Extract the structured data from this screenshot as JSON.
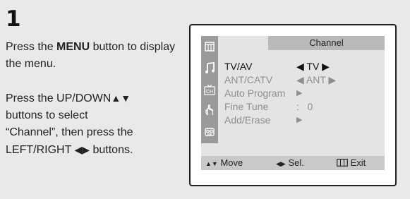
{
  "step": {
    "number": "1"
  },
  "instructions": {
    "p1_before": "Press the ",
    "p1_bold": "MENU",
    "p1_after": " button to display the menu.",
    "p2_line1": "Press the UP/DOWN",
    "p2_updown_glyph": "▲▼",
    "p2_line2": "buttons to select",
    "p2_line3": "“Channel”, then press the",
    "p2_line4_before": "LEFT/RIGHT ",
    "p2_leftright_glyph": "◀▶",
    "p2_line4_after": " buttons."
  },
  "osd": {
    "title": "Channel",
    "icons": [
      "picture-icon",
      "sound-icon",
      "channel-icon",
      "function-icon",
      "input-icon"
    ],
    "rows": [
      {
        "label": "TV/AV",
        "value": "◀ TV ▶",
        "state": "active"
      },
      {
        "label": "ANT/CATV",
        "value": "◀ ANT ▶",
        "state": "dim"
      },
      {
        "label": "Auto Program",
        "value": "▶",
        "state": "dim"
      },
      {
        "label": "Fine Tune",
        "value": ":   0",
        "state": "dim"
      },
      {
        "label": "Add/Erase",
        "value": "▶",
        "state": "dim"
      }
    ],
    "footer": {
      "move_glyph": "▲▼",
      "move_label": "Move",
      "sel_glyph": "◀▶",
      "sel_label": "Sel.",
      "exit_label": "Exit"
    }
  },
  "colors": {
    "panel_bg": "#e9e9e9",
    "osd_bg": "#e4e4e4",
    "title_bar": "#b9b9b9",
    "icon_column": "#9a9a9a",
    "footer_bar": "#c9c9c9",
    "dim_text": "#8e8e8e"
  }
}
